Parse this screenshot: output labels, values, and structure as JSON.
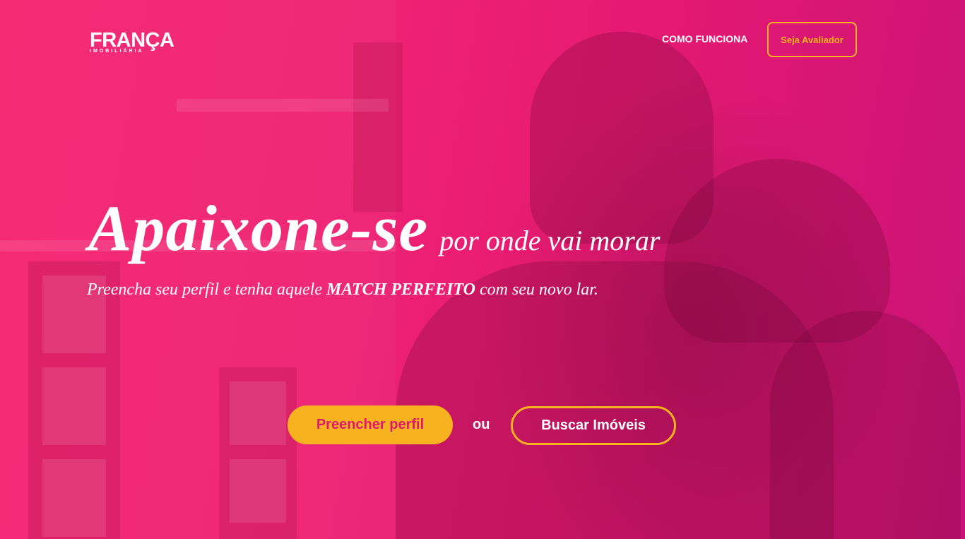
{
  "brand": {
    "name": "FRANÇA",
    "tagline": "IMOBILIÁRIA"
  },
  "nav": {
    "how_it_works": "COMO FUNCIONA",
    "be_evaluator": "Seja Avaliador"
  },
  "hero": {
    "headline_main": "Apaixone-se",
    "headline_rest": "por onde vai morar",
    "sub_before": "Preencha seu perfil e tenha aquele",
    "sub_emphasis": "MATCH PERFEITO",
    "sub_after": "com seu novo lar."
  },
  "cta": {
    "primary": "Preencher perfil",
    "separator": "ou",
    "secondary": "Buscar Imóveis"
  },
  "colors": {
    "background": "#e81c6e",
    "accent": "#f6b31f",
    "text": "#ffffff"
  }
}
